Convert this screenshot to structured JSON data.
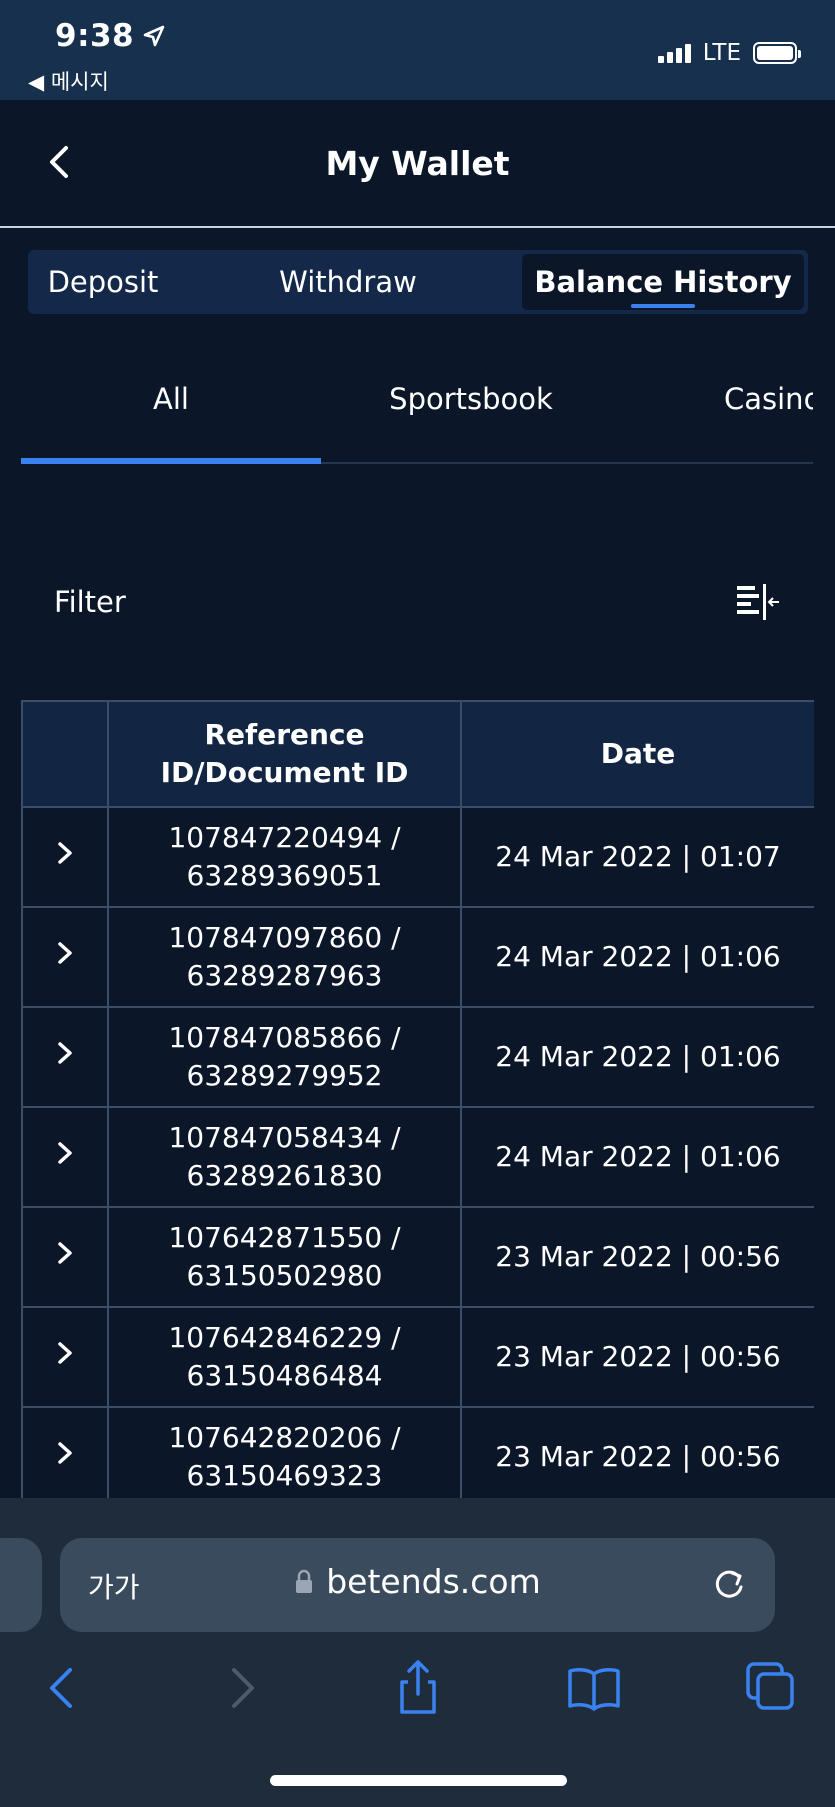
{
  "status_bar": {
    "time": "9:38",
    "back_label": "◀ 메시지",
    "network": "LTE"
  },
  "header": {
    "title": "My Wallet"
  },
  "segmented_tabs": [
    {
      "label": "Deposit",
      "active": false
    },
    {
      "label": "Withdraw",
      "active": false
    },
    {
      "label": "Balance History",
      "active": true
    }
  ],
  "sub_tabs": [
    {
      "label": "All",
      "active": true
    },
    {
      "label": "Sportsbook",
      "active": false
    },
    {
      "label": "Casino",
      "active": false
    }
  ],
  "filter": {
    "label": "Filter",
    "icon": "filter-collapse-icon"
  },
  "table": {
    "headers": [
      "",
      "Reference\nID/Document ID",
      "Date"
    ],
    "header_ref_line1": "Reference",
    "header_ref_line2": "ID/Document ID",
    "header_date": "Date",
    "rows": [
      {
        "ref": "107847220494 /",
        "doc": "63289369051",
        "date": "24 Mar 2022 | 01:07"
      },
      {
        "ref": "107847097860 /",
        "doc": "63289287963",
        "date": "24 Mar 2022 | 01:06"
      },
      {
        "ref": "107847085866 /",
        "doc": "63289279952",
        "date": "24 Mar 2022 | 01:06"
      },
      {
        "ref": "107847058434 /",
        "doc": "63289261830",
        "date": "24 Mar 2022 | 01:06"
      },
      {
        "ref": "107642871550 /",
        "doc": "63150502980",
        "date": "23 Mar 2022 | 00:56"
      },
      {
        "ref": "107642846229 /",
        "doc": "63150486484",
        "date": "23 Mar 2022 | 00:56"
      },
      {
        "ref": "107642820206 /",
        "doc": "63150469323",
        "date": "23 Mar 2022 | 00:56"
      }
    ]
  },
  "browser": {
    "text_size_label": "가가",
    "host": "betends.com"
  },
  "colors": {
    "background": "#0b1628",
    "status_bar": "#16304e",
    "accent": "#3a82f0",
    "table_header": "#122643",
    "table_border": "#3a4e68",
    "browser_chrome": "#1e2c3c",
    "browser_icon": "#3a82f0"
  }
}
